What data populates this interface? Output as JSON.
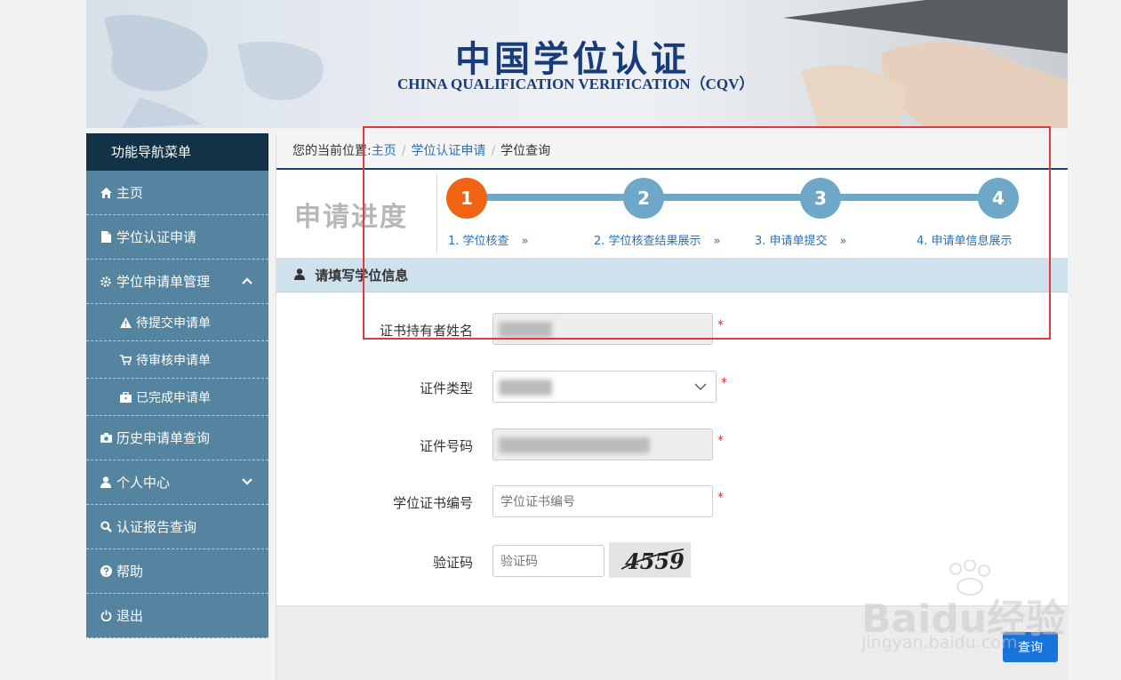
{
  "header": {
    "title_cn": "中国学位认证",
    "title_en": "CHINA QUALIFICATION VERIFICATION（CQV）"
  },
  "sidebar": {
    "title": "功能导航菜单",
    "items": [
      {
        "label": "主页",
        "icon": "home-icon"
      },
      {
        "label": "学位认证申请",
        "icon": "file-icon"
      },
      {
        "label": "学位申请单管理",
        "icon": "gear-icon"
      },
      {
        "label": "待提交申请单",
        "icon": "warning-icon"
      },
      {
        "label": "待审核申请单",
        "icon": "cart-icon"
      },
      {
        "label": "已完成申请单",
        "icon": "briefcase-icon"
      },
      {
        "label": "历史申请单查询",
        "icon": "camera-icon"
      },
      {
        "label": "个人中心",
        "icon": "user-icon"
      },
      {
        "label": "认证报告查询",
        "icon": "search-icon"
      },
      {
        "label": "帮助",
        "icon": "help-icon"
      },
      {
        "label": "退出",
        "icon": "power-icon"
      }
    ]
  },
  "breadcrumb": {
    "prefix": "您的当前位置:",
    "home": "主页",
    "sep1": "/",
    "level1": "学位认证申请",
    "sep2": "/",
    "current": "学位查询"
  },
  "progress": {
    "label": "申请进度",
    "steps": [
      {
        "num": "1",
        "label": "1. 学位核查",
        "arrow": "»"
      },
      {
        "num": "2",
        "label": "2. 学位核查结果展示",
        "arrow": "»"
      },
      {
        "num": "3",
        "label": "3. 申请单提交",
        "arrow": "»"
      },
      {
        "num": "4",
        "label": "4. 申请单信息展示",
        "arrow": ""
      }
    ],
    "current_step": 1
  },
  "form": {
    "section_title": "请填写学位信息",
    "required_mark": "*",
    "holder_name_label": "证书持有者姓名",
    "id_type_label": "证件类型",
    "id_number_label": "证件号码",
    "cert_number_label": "学位证书编号",
    "cert_number_placeholder": "学位证书编号",
    "captcha_label": "验证码",
    "captcha_placeholder": "验证码",
    "captcha_text": "4559"
  },
  "actions": {
    "query_label": "查询"
  },
  "watermark": {
    "brand": "Baidu经验",
    "url": "jingyan.baidu.com"
  },
  "colors": {
    "nav_bg": "#54849f",
    "nav_title_bg": "#123247",
    "active_step": "#f06312",
    "step": "#6ea7c8",
    "link": "#2c6fb4",
    "annotation_box": "#e0393e"
  }
}
